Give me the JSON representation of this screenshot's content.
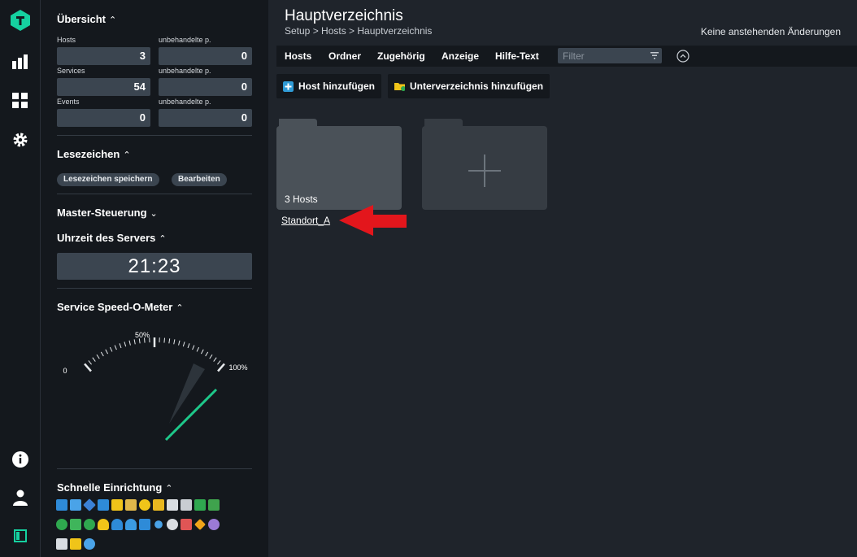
{
  "overview": {
    "title": "Übersicht",
    "hosts_label": "Hosts",
    "hosts_value": "3",
    "hosts_unhandled_label": "unbehandelte p.",
    "hosts_unhandled_value": "0",
    "services_label": "Services",
    "services_value": "54",
    "services_unhandled_label": "unbehandelte p.",
    "services_unhandled_value": "0",
    "events_label": "Events",
    "events_value": "0",
    "events_unhandled_label": "unbehandelte p.",
    "events_unhandled_value": "0"
  },
  "bookmarks": {
    "title": "Lesezeichen",
    "save_label": "Lesezeichen speichern",
    "edit_label": "Bearbeiten"
  },
  "master_control": {
    "title": "Master-Steuerung"
  },
  "server_time": {
    "title": "Uhrzeit des Servers",
    "value": "21:23"
  },
  "speedometer": {
    "title": "Service Speed-O-Meter",
    "label_min": "0",
    "label_mid": "50%",
    "label_max": "100%"
  },
  "quick_setup": {
    "title": "Schnelle Einrichtung"
  },
  "main": {
    "title": "Hauptverzeichnis",
    "breadcrumb": "Setup > Hosts > Hauptverzeichnis",
    "pending": "Keine anstehenden Änderungen",
    "menu": {
      "hosts": "Hosts",
      "folder": "Ordner",
      "related": "Zugehörig",
      "display": "Anzeige",
      "help": "Hilfe-Text"
    },
    "filter_placeholder": "Filter",
    "add_host": "Host hinzufügen",
    "add_subfolder": "Unterverzeichnis hinzufügen",
    "folder_hosts": "3 Hosts",
    "folder_name": "Standort_A"
  },
  "colors": {
    "brand": "#15d1a0",
    "arrow": "#e3161c",
    "speed_needle": "#1ec88a"
  }
}
